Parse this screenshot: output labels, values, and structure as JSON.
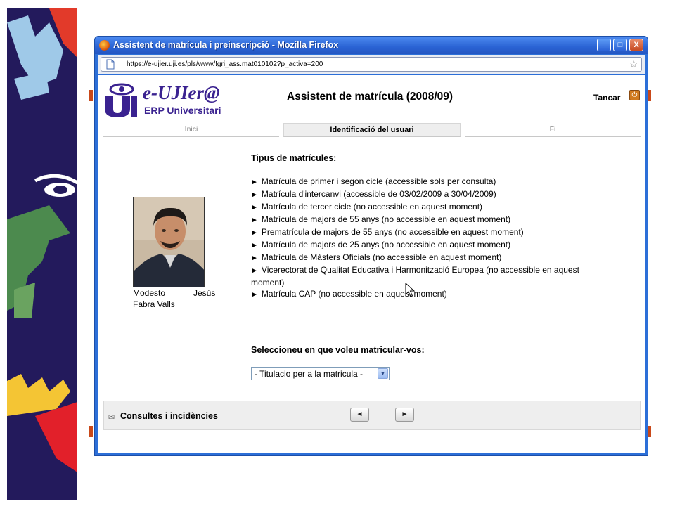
{
  "window": {
    "title": "Assistent de matrícula i preinscripció - Mozilla Firefox",
    "url": "https://e-ujier.uji.es/pls/www/!gri_ass.mat010102?p_activa=200",
    "buttons": {
      "minimize": "_",
      "maximize": "□",
      "close": "X"
    }
  },
  "header": {
    "brand": "e-UJIer@",
    "brand_sub": "ERP Universitari",
    "page_title": "Assistent de matrícula (2008/09)",
    "close_label": "Tancar"
  },
  "steps": [
    {
      "label": "Inici",
      "active": false
    },
    {
      "label": "Identificació del usuari",
      "active": true
    },
    {
      "label": "Fi",
      "active": false
    }
  ],
  "person": {
    "first_name": "Modesto",
    "middle_name": "Jesús",
    "surnames": "Fabra Valls"
  },
  "types": {
    "title": "Tipus de matrícules:",
    "items": [
      "Matrícula de primer i segon cicle (accessible sols per consulta)",
      "Matrícula d'intercanvi (accessible de 03/02/2009 a 30/04/2009)",
      "Matrícula de tercer cicle (no accessible en aquest moment)",
      "Matrícula de majors de 55 anys (no accessible en aquest moment)",
      "Prematrícula de majors de 55 anys (no accessible en aquest moment)",
      "Matrícula de majors de 25 anys (no accessible en aquest moment)",
      "Matrícula de Màsters Oficials (no accessible en aquest moment)",
      "Vicerectorat de Qualitat Educativa i Harmonització Europea (no accessible en aquest moment)",
      "Matrícula CAP (no accessible en aquest moment)"
    ]
  },
  "selection": {
    "title": "Seleccioneu en que voleu matricular-vos:",
    "selected": "- Titulacio per a la matricula -"
  },
  "footer": {
    "label": "Consultes i incidències",
    "prev": "◄",
    "next": "►"
  },
  "icons": {
    "bullet": "►",
    "mail": "✉",
    "star": "☆",
    "dropdown": "▼",
    "power": "⏻"
  }
}
